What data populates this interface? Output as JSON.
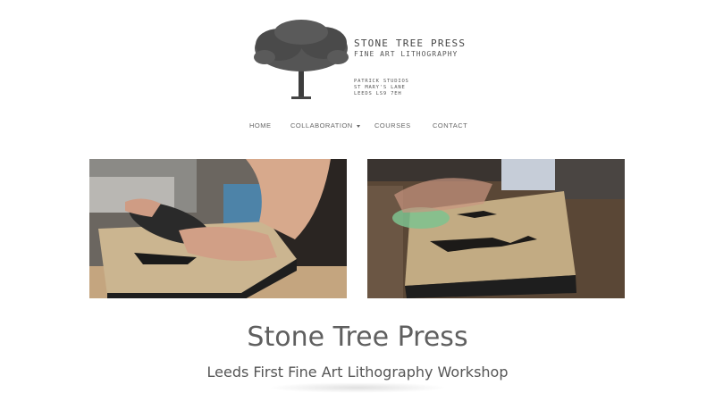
{
  "brand": {
    "name": "STONE TREE PRESS",
    "tagline": "FINE ART LITHOGRAPHY",
    "address": [
      "PATRICK STUDIOS",
      "ST MARY'S LANE",
      "LEEDS LS9 7EH"
    ]
  },
  "nav": {
    "home": "HOME",
    "collaboration": "COLLABORATION",
    "courses": "COURSES",
    "contact": "CONTACT"
  },
  "hero": {
    "title": "Stone Tree Press",
    "subtitle": "Leeds First Fine Art Lithography Workshop"
  },
  "icons": {
    "logo": "tree-icon",
    "dropdown": "chevron-down-icon"
  }
}
